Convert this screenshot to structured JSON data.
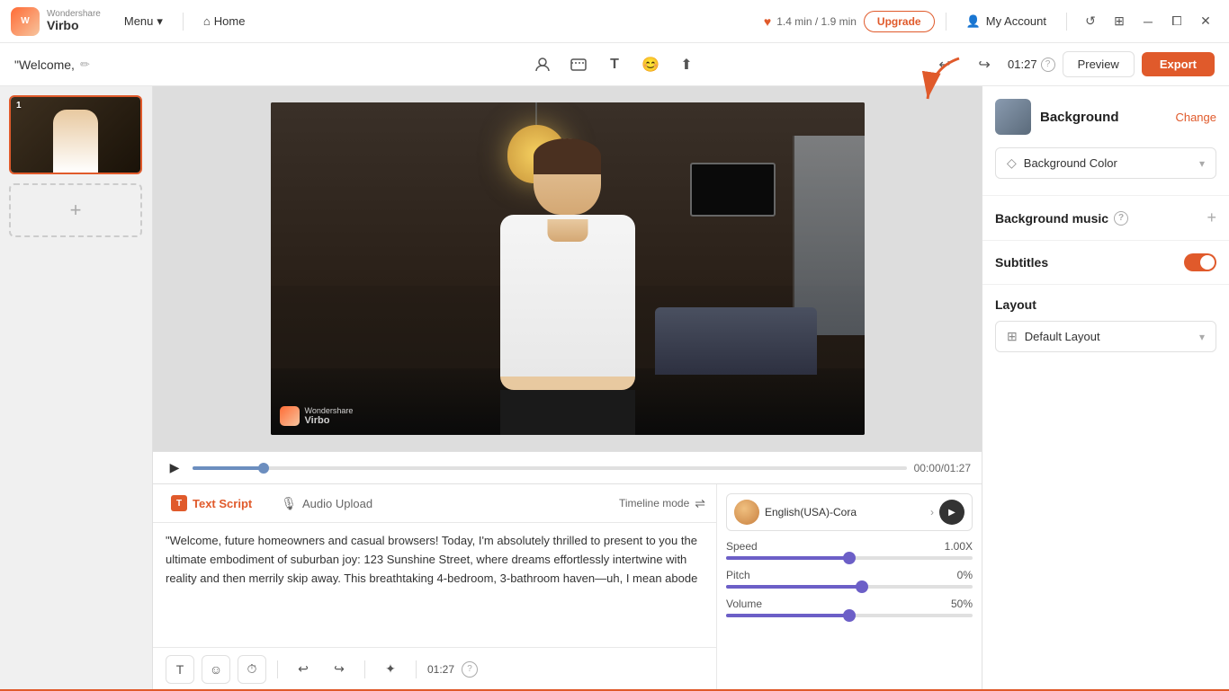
{
  "app": {
    "brand_top": "Wondershare",
    "brand_bottom": "Virbo",
    "menu_label": "Menu",
    "home_label": "Home"
  },
  "titlebar": {
    "credit_info": "1.4 min / 1.9 min",
    "upgrade_label": "Upgrade",
    "account_label": "My Account"
  },
  "toolbar": {
    "project_title": "\"Welcome,",
    "time_display": "01:27",
    "help_icon": "?",
    "preview_label": "Preview",
    "export_label": "Export"
  },
  "playback": {
    "time_current": "00:00",
    "time_total": "01:27",
    "progress_percent": 10
  },
  "tabs": {
    "text_script_label": "Text Script",
    "audio_upload_label": "Audio Upload",
    "timeline_mode_label": "Timeline mode"
  },
  "text_content": "\"Welcome, future homeowners and casual browsers! Today, I'm absolutely thrilled to present to you the ultimate embodiment of suburban joy: 123 Sunshine Street, where dreams effortlessly intertwine with reality and then merrily skip away. This breathtaking 4-bedroom, 3-bathroom haven—uh, I mean abode",
  "voice": {
    "name": "English(USA)-Cora",
    "speed_label": "Speed",
    "speed_value": "1.00X",
    "speed_percent": 50,
    "pitch_label": "Pitch",
    "pitch_value": "0%",
    "pitch_percent": 55,
    "volume_label": "Volume",
    "volume_value": "50%",
    "volume_percent": 50
  },
  "bottom_toolbar": {
    "time_display": "01:27"
  },
  "right_panel": {
    "background_label": "Background",
    "change_label": "Change",
    "background_color_label": "Background Color",
    "background_music_label": "Background music",
    "subtitles_label": "Subtitles",
    "layout_label": "Layout",
    "default_layout_label": "Default Layout"
  },
  "slide": {
    "number": "1"
  },
  "watermark": {
    "name": "Wondershare",
    "product": "Virbo"
  }
}
